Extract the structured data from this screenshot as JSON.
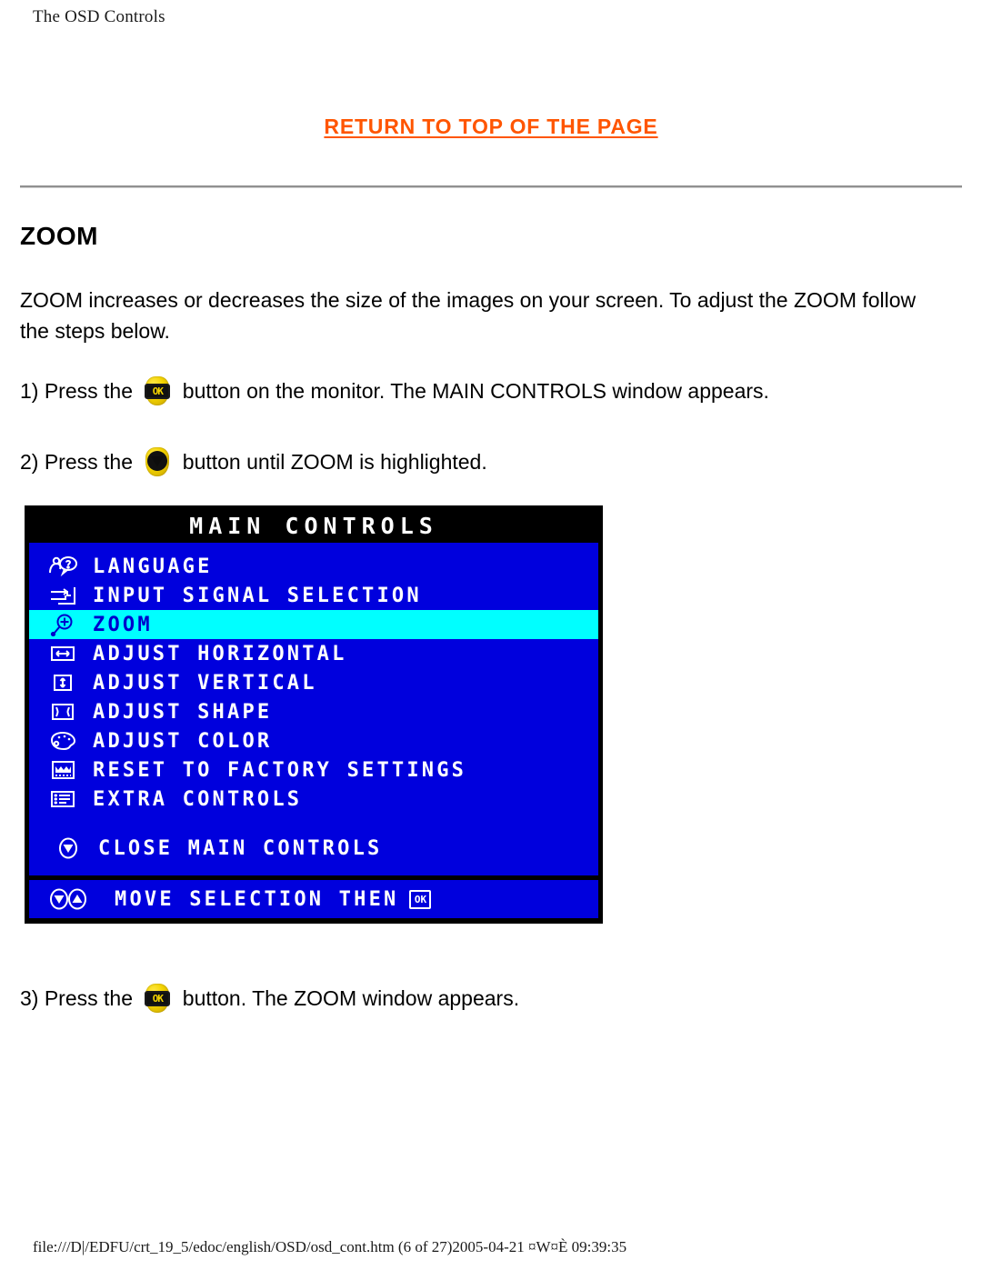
{
  "header": {
    "title": "The OSD Controls"
  },
  "return_link": {
    "label": "RETURN TO TOP OF THE PAGE",
    "color": "#ff5500"
  },
  "section": {
    "title": "ZOOM",
    "paragraph": "ZOOM increases or decreases the size of the images on your screen. To adjust the ZOOM follow the steps below."
  },
  "steps": [
    {
      "number": "1)",
      "before": "1) Press the ",
      "icon": "ok-button-icon",
      "after": " button on the monitor. The MAIN CONTROLS window appears."
    },
    {
      "number": "2)",
      "before": "2) Press the ",
      "icon": "down-button-icon",
      "after": " button until ZOOM is highlighted."
    },
    {
      "number": "3)",
      "before": "3) Press the ",
      "icon": "ok-button-icon",
      "after": " button. The ZOOM window appears."
    }
  ],
  "osd": {
    "title": "MAIN CONTROLS",
    "colors": {
      "background": "#0000dd",
      "border": "#000000",
      "text": "#ffffff",
      "highlight_bg": "#00ffff",
      "highlight_text": "#0000cc"
    },
    "items": [
      {
        "label": "LANGUAGE",
        "icon": "language-icon",
        "selected": false
      },
      {
        "label": "INPUT SIGNAL SELECTION",
        "icon": "input-signal-icon",
        "selected": false
      },
      {
        "label": "ZOOM",
        "icon": "zoom-magnifier-icon",
        "selected": true
      },
      {
        "label": "ADJUST HORIZONTAL",
        "icon": "horizontal-arrows-icon",
        "selected": false
      },
      {
        "label": "ADJUST VERTICAL",
        "icon": "vertical-arrows-icon",
        "selected": false
      },
      {
        "label": "ADJUST SHAPE",
        "icon": "shape-icon",
        "selected": false
      },
      {
        "label": "ADJUST COLOR",
        "icon": "palette-icon",
        "selected": false
      },
      {
        "label": "RESET TO FACTORY SETTINGS",
        "icon": "factory-reset-icon",
        "selected": false
      },
      {
        "label": "EXTRA CONTROLS",
        "icon": "extra-controls-icon",
        "selected": false
      }
    ],
    "close_item": {
      "label": "CLOSE MAIN CONTROLS",
      "icon": "close-down-icon"
    },
    "footer": {
      "label": "MOVE SELECTION THEN",
      "ok_label": "OK",
      "icon": "down-up-icon"
    }
  },
  "page_footer": {
    "text": "file:///D|/EDFU/crt_19_5/edoc/english/OSD/osd_cont.htm (6 of 27)2005-04-21 ¤W¤È 09:39:35"
  }
}
